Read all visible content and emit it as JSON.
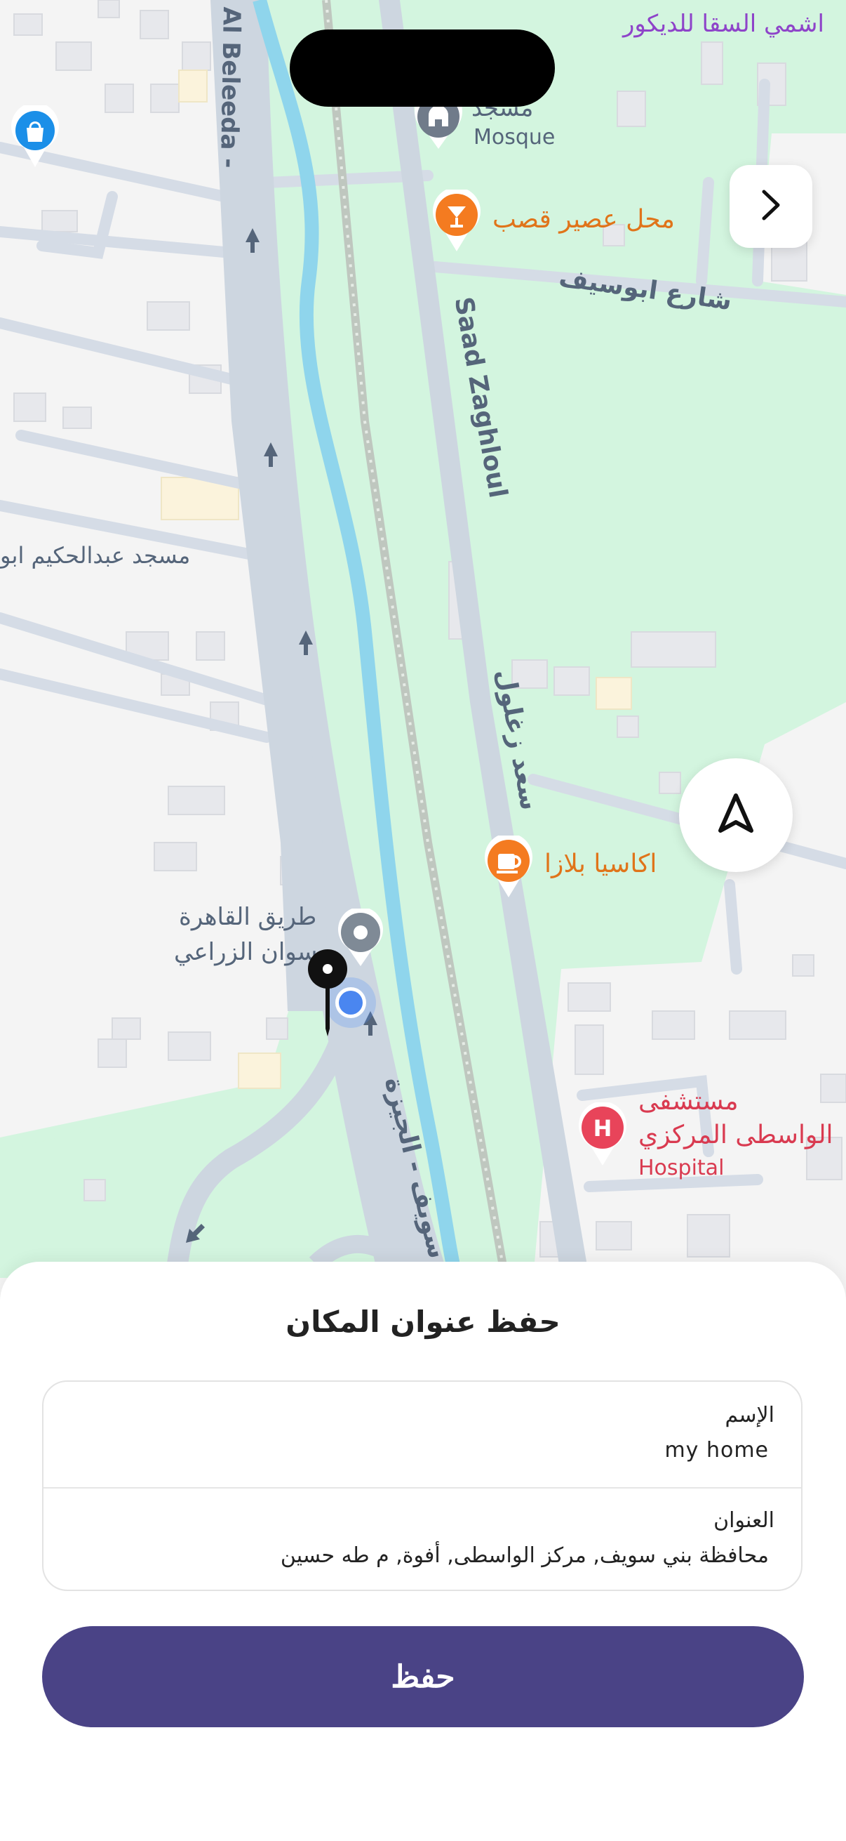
{
  "map": {
    "labels": {
      "top_right_business": "اشمي السقا للديكور",
      "mosque_ar": "مسجد",
      "mosque_en": "Mosque",
      "juice_shop": "محل عصير قصب",
      "street_abousef": "شارع ابوسيف",
      "al_beleeda": "Al Beleeda -",
      "saad_zaghloul_en": "Saad Zaghloul",
      "saad_zaghloul_ar": "سعد زغلول",
      "mosque_abdelhakim": "مسجد عبدالحكيم ابو",
      "acacia_plaza": "اكاسيا بلازا",
      "cairo_road_line1": "طريق القاهرة",
      "cairo_road_line2": "سوان الزراعي",
      "hospital_line1": "مستشفى",
      "hospital_line2": "الواسطى المركزي",
      "hospital_en": "Hospital",
      "giza_road": "سويف - الجيزة"
    },
    "icons": {
      "shop_pin": "shopping-bag-icon",
      "mosque_pin": "mosque-icon",
      "juice_pin": "cocktail-icon",
      "cafe_pin": "coffee-cup-icon",
      "hospital_pin": "hospital-icon",
      "next": "chevron-right-icon",
      "locate": "navigation-arrow-icon"
    },
    "colors": {
      "land": "#f4f4f4",
      "park": "#d3f5df",
      "road": "#cdd6e0",
      "water": "#8fd5ec",
      "poi_orange": "#f47b20",
      "poi_red": "#e8445a",
      "label_purple": "#8e44c9",
      "label_blue": "#55657a"
    }
  },
  "sheet": {
    "title": "حفظ عنوان المكان",
    "name_label": "الإسم",
    "name_value": "my home",
    "address_label": "العنوان",
    "address_value": "محافظة بني سويف, مركز الواسطى, أفوة, م طه حسين",
    "save_label": "حفظ"
  },
  "colors": {
    "save_button": "#4a4386"
  }
}
